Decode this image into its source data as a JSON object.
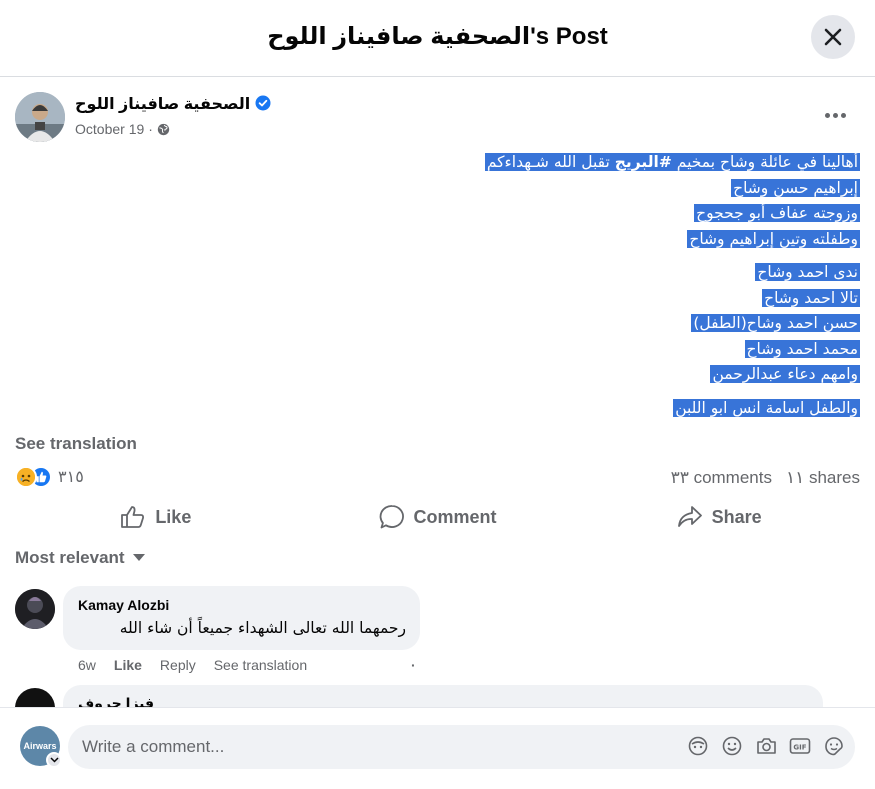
{
  "header": {
    "title": "الصحفية صافيناز اللوح's Post"
  },
  "post": {
    "author": "الصحفية صافيناز اللوح",
    "date": "October 19",
    "meta_sep": "·",
    "paragraphs": [
      [
        {
          "pre": "أهالينا في عائلة وشاح بمخيم ",
          "bold": "#البريج",
          "post": " تقبل الله شـهداءكم"
        },
        {
          "pre": "إبراهيم حسن وشاح",
          "bold": "",
          "post": ""
        },
        {
          "pre": "وزوجته عفاف أبو جحجوح",
          "bold": "",
          "post": ""
        },
        {
          "pre": "وطفلته وتين إبراهيم وشاح",
          "bold": "",
          "post": ""
        }
      ],
      [
        {
          "pre": "ندى احمد وشاح",
          "bold": "",
          "post": ""
        },
        {
          "pre": "تالا احمد وشاح",
          "bold": "",
          "post": ""
        },
        {
          "pre": "حسن احمد وشاح(الطفل)",
          "bold": "",
          "post": ""
        },
        {
          "pre": "محمد احمد وشاح",
          "bold": "",
          "post": ""
        },
        {
          "pre": "وامهم دعاء عبدالرحمن",
          "bold": "",
          "post": ""
        }
      ],
      [
        {
          "pre": "والطفل اسامة انس ابو اللبن",
          "bold": "",
          "post": ""
        }
      ]
    ],
    "see_translation": "See translation",
    "reaction_count": "٣١٥",
    "comments_count": "٣٣ comments",
    "shares_count": "١١ shares"
  },
  "actions": {
    "like": "Like",
    "comment": "Comment",
    "share": "Share"
  },
  "sort": {
    "label": "Most relevant"
  },
  "comments": [
    {
      "author": "Kamay Alozbi",
      "text": "رحمهما الله تعالى الشهداء جميعاً أن شاء الله",
      "time": "6w",
      "like": "Like",
      "reply": "Reply",
      "see_translation": "See translation",
      "dot": "·"
    },
    {
      "author": "فيزا حروف"
    }
  ],
  "composer": {
    "avatar_text": "Airwars",
    "placeholder": "Write a comment..."
  },
  "colors": {
    "highlight": "#3874d8",
    "brand": "#1877f2",
    "muted": "#65676b"
  }
}
